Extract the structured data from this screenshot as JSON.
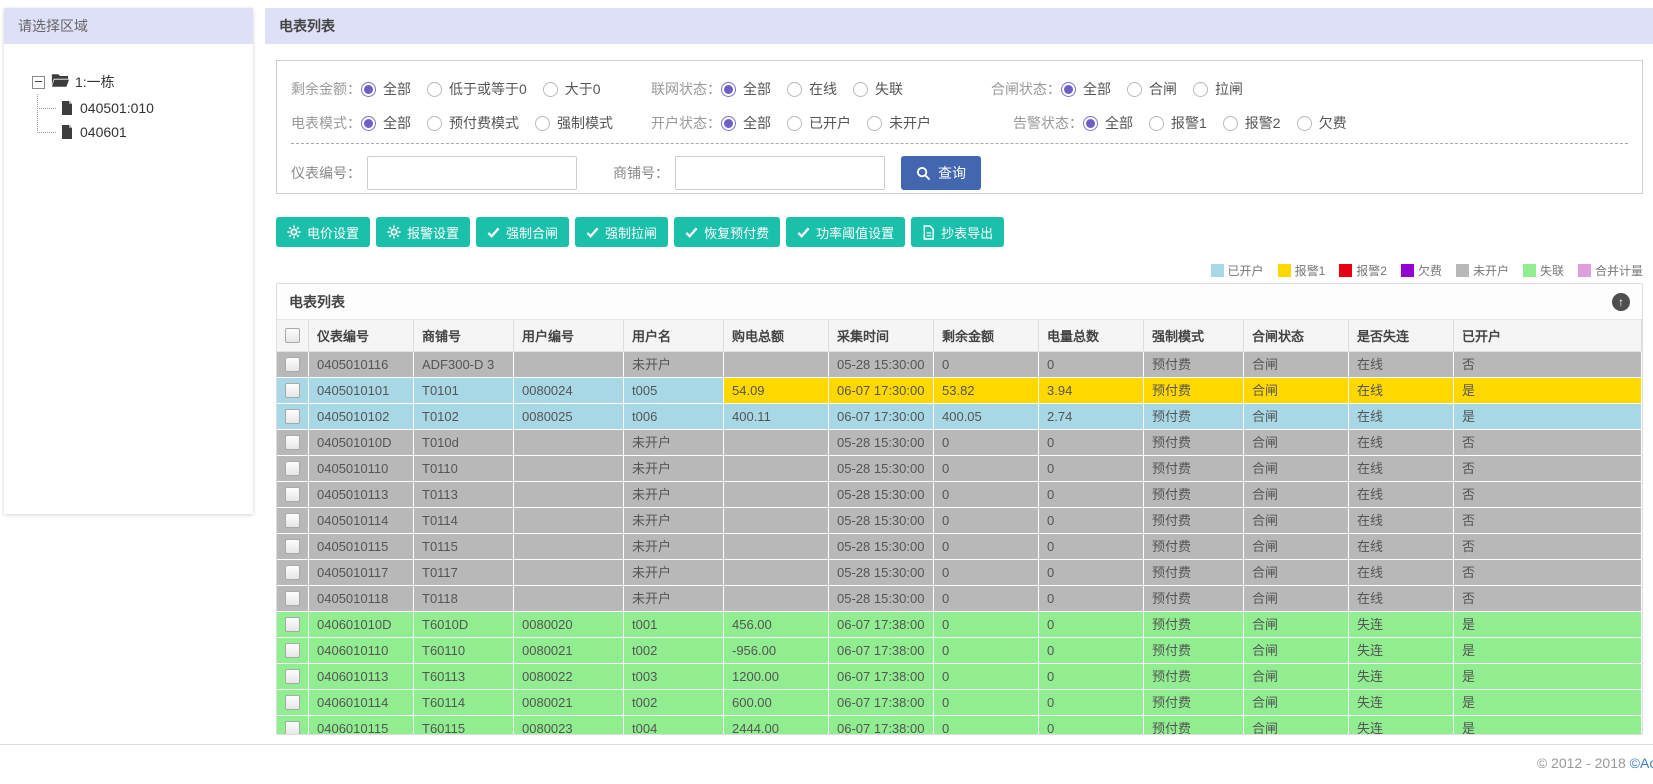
{
  "sidebar": {
    "title": "请选择区域",
    "tree": {
      "root": "1:一栋",
      "children": [
        "040501:010",
        "040601"
      ]
    }
  },
  "main": {
    "title": "电表列表",
    "filters_groups": [
      {
        "label": "剩余金额：",
        "options": [
          "全部",
          "低于或等于0",
          "大于0"
        ],
        "selected": 0
      },
      {
        "label": "联网状态：",
        "options": [
          "全部",
          "在线",
          "失联"
        ],
        "selected": 0
      },
      {
        "label": "合闸状态：",
        "options": [
          "全部",
          "合闸",
          "拉闸"
        ],
        "selected": 0
      },
      {
        "label": "电表模式：",
        "options": [
          "全部",
          "预付费模式",
          "强制模式"
        ],
        "selected": 0
      },
      {
        "label": "开户状态：",
        "options": [
          "全部",
          "已开户",
          "未开户"
        ],
        "selected": 0
      },
      {
        "label": "告警状态：",
        "options": [
          "全部",
          "报警1",
          "报警2",
          "欠费"
        ],
        "selected": 0
      }
    ],
    "search": {
      "meter_label": "仪表编号：",
      "meter_value": "",
      "shop_label": "商铺号：",
      "shop_value": "",
      "button": "查询"
    },
    "actions": [
      {
        "icon": "gear-icon",
        "label": "电价设置"
      },
      {
        "icon": "gear-icon",
        "label": "报警设置"
      },
      {
        "icon": "check-icon",
        "label": "强制合闸"
      },
      {
        "icon": "check-icon",
        "label": "强制拉闸"
      },
      {
        "icon": "check-icon",
        "label": "恢复预付费"
      },
      {
        "icon": "check-icon",
        "label": "功率阈值设置"
      },
      {
        "icon": "file-icon",
        "label": "抄表导出"
      }
    ],
    "legend": [
      {
        "label": "已开户",
        "color": "#a8d8e6"
      },
      {
        "label": "报警1",
        "color": "#ffd800"
      },
      {
        "label": "报警2",
        "color": "#e60012"
      },
      {
        "label": "欠费",
        "color": "#9400d3"
      },
      {
        "label": "未开户",
        "color": "#b8b8b8"
      },
      {
        "label": "失联",
        "color": "#90ee90"
      },
      {
        "label": "合并计量",
        "color": "#dda0dd"
      }
    ],
    "table": {
      "title": "电表列表",
      "columns": [
        "仪表编号",
        "商铺号",
        "用户编号",
        "用户名",
        "购电总额",
        "采集时间",
        "剩余金额",
        "电量总数",
        "强制模式",
        "合闸状态",
        "是否失连",
        "已开户"
      ],
      "row_colors": {
        "opened": "#a8d8e6",
        "alarm1": "#ffd800",
        "unopened": "#b8b8b8",
        "offline": "#90ee90"
      },
      "rows": [
        {
          "color": "unopened",
          "cells": [
            "0405010116",
            "ADF300-D 3",
            "",
            "未开户",
            "",
            "05-28 15:30:00",
            "0",
            "0",
            "预付费",
            "合闸",
            "在线",
            "否"
          ]
        },
        {
          "color": "opened",
          "alt_color": "alarm1",
          "alt_from": 4,
          "cells": [
            "0405010101",
            "T0101",
            "0080024",
            "t005",
            "54.09",
            "06-07 17:30:00",
            "53.82",
            "3.94",
            "预付费",
            "合闸",
            "在线",
            "是"
          ]
        },
        {
          "color": "opened",
          "cells": [
            "0405010102",
            "T0102",
            "0080025",
            "t006",
            "400.11",
            "06-07 17:30:00",
            "400.05",
            "2.74",
            "预付费",
            "合闸",
            "在线",
            "是"
          ]
        },
        {
          "color": "unopened",
          "cells": [
            "040501010D",
            "T010d",
            "",
            "未开户",
            "",
            "05-28 15:30:00",
            "0",
            "0",
            "预付费",
            "合闸",
            "在线",
            "否"
          ]
        },
        {
          "color": "unopened",
          "cells": [
            "0405010110",
            "T0110",
            "",
            "未开户",
            "",
            "05-28 15:30:00",
            "0",
            "0",
            "预付费",
            "合闸",
            "在线",
            "否"
          ]
        },
        {
          "color": "unopened",
          "cells": [
            "0405010113",
            "T0113",
            "",
            "未开户",
            "",
            "05-28 15:30:00",
            "0",
            "0",
            "预付费",
            "合闸",
            "在线",
            "否"
          ]
        },
        {
          "color": "unopened",
          "cells": [
            "0405010114",
            "T0114",
            "",
            "未开户",
            "",
            "05-28 15:30:00",
            "0",
            "0",
            "预付费",
            "合闸",
            "在线",
            "否"
          ]
        },
        {
          "color": "unopened",
          "cells": [
            "0405010115",
            "T0115",
            "",
            "未开户",
            "",
            "05-28 15:30:00",
            "0",
            "0",
            "预付费",
            "合闸",
            "在线",
            "否"
          ]
        },
        {
          "color": "unopened",
          "cells": [
            "0405010117",
            "T0117",
            "",
            "未开户",
            "",
            "05-28 15:30:00",
            "0",
            "0",
            "预付费",
            "合闸",
            "在线",
            "否"
          ]
        },
        {
          "color": "unopened",
          "cells": [
            "0405010118",
            "T0118",
            "",
            "未开户",
            "",
            "05-28 15:30:00",
            "0",
            "0",
            "预付费",
            "合闸",
            "在线",
            "否"
          ]
        },
        {
          "color": "offline",
          "cells": [
            "040601010D",
            "T6010D",
            "0080020",
            "t001",
            "456.00",
            "06-07 17:38:00",
            "0",
            "0",
            "预付费",
            "合闸",
            "失连",
            "是"
          ]
        },
        {
          "color": "offline",
          "cells": [
            "0406010110",
            "T60110",
            "0080021",
            "t002",
            "-956.00",
            "06-07 17:38:00",
            "0",
            "0",
            "预付费",
            "合闸",
            "失连",
            "是"
          ]
        },
        {
          "color": "offline",
          "cells": [
            "0406010113",
            "T60113",
            "0080022",
            "t003",
            "1200.00",
            "06-07 17:38:00",
            "0",
            "0",
            "预付费",
            "合闸",
            "失连",
            "是"
          ]
        },
        {
          "color": "offline",
          "cells": [
            "0406010114",
            "T60114",
            "0080021",
            "t002",
            "600.00",
            "06-07 17:38:00",
            "0",
            "0",
            "预付费",
            "合闸",
            "失连",
            "是"
          ]
        },
        {
          "color": "offline",
          "cells": [
            "0406010115",
            "T60115",
            "0080023",
            "t004",
            "2444.00",
            "06-07 17:38:00",
            "0",
            "0",
            "预付费",
            "合闸",
            "失连",
            "是"
          ]
        }
      ]
    },
    "footer": {
      "text": "© 2012 - 2018 ",
      "link": "©Acr"
    }
  },
  "colors": {
    "header_bar": "#dde0f7",
    "teal_button": "#1bc0aa",
    "blue_button": "#4266b0",
    "radio_selected": "#6c5fc7"
  }
}
